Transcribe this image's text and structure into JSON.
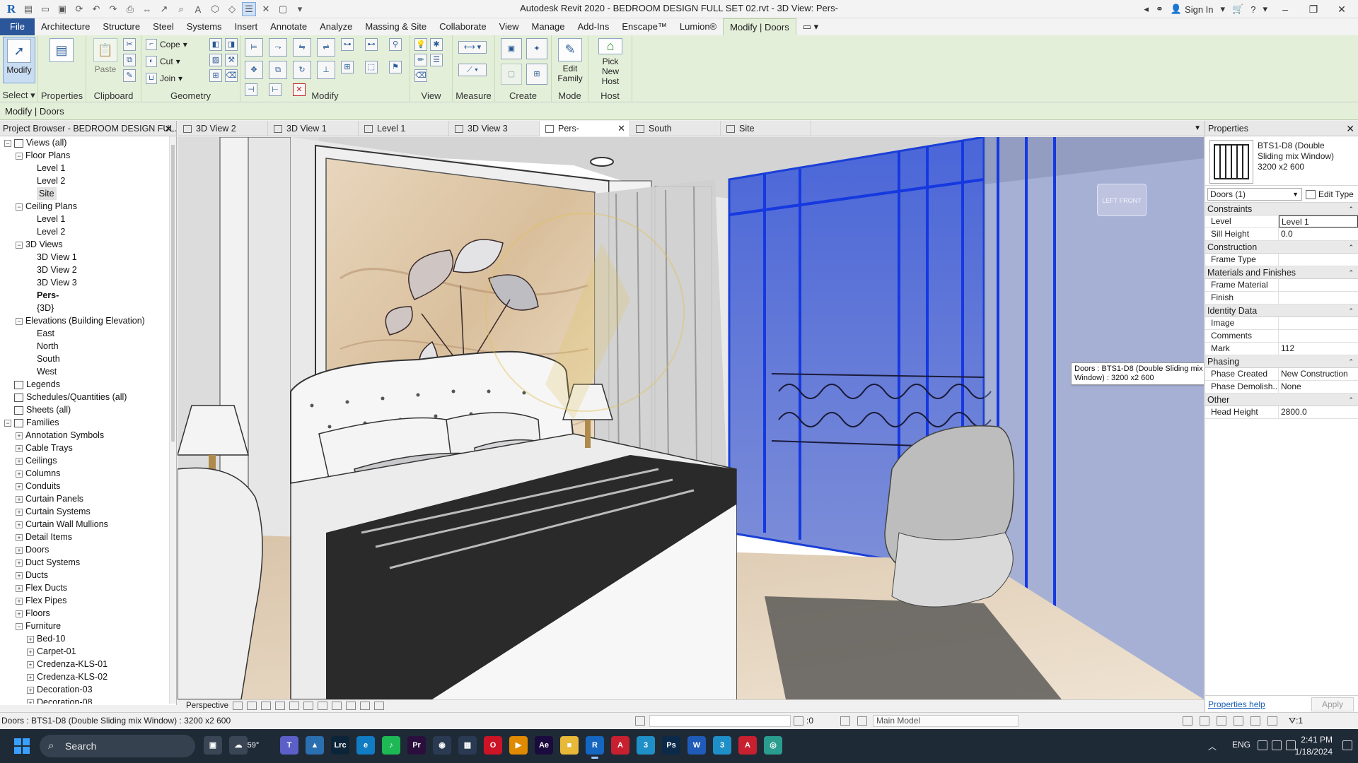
{
  "window": {
    "title": "Autodesk Revit 2020 - BEDROOM DESIGN FULL SET 02.rvt - 3D View: Pers-",
    "sign_in": "Sign In",
    "app_logo": "R"
  },
  "ribbon_tabs": [
    "File",
    "Architecture",
    "Structure",
    "Steel",
    "Systems",
    "Insert",
    "Annotate",
    "Analyze",
    "Massing & Site",
    "Collaborate",
    "View",
    "Manage",
    "Add-Ins",
    "Enscape™",
    "Lumion®",
    "Modify | Doors"
  ],
  "ribbon": {
    "select_panel": {
      "modify_label": "Modify",
      "label": "Select"
    },
    "properties_panel": {
      "label": "Properties"
    },
    "clipboard_panel": {
      "paste_label": "Paste",
      "label": "Clipboard"
    },
    "geometry_panel": {
      "cope": "Cope",
      "cut": "Cut",
      "join": "Join",
      "label": "Geometry"
    },
    "modify_panel": {
      "label": "Modify"
    },
    "view_panel": {
      "label": "View"
    },
    "measure_panel": {
      "label": "Measure"
    },
    "create_panel": {
      "label": "Create"
    },
    "mode_panel": {
      "edit_family": "Edit Family",
      "label": "Mode"
    },
    "host_panel": {
      "pick_new_host": "Pick New Host",
      "label": "Host"
    }
  },
  "context_bar": "Modify | Doors",
  "project_browser": {
    "title": "Project Browser - BEDROOM DESIGN FUL...",
    "nodes": [
      {
        "label": "Views (all)",
        "indent": 0,
        "toggle": "-",
        "icon": true
      },
      {
        "label": "Floor Plans",
        "indent": 1,
        "toggle": "-"
      },
      {
        "label": "Level 1",
        "indent": 2
      },
      {
        "label": "Level 2",
        "indent": 2
      },
      {
        "label": "Site",
        "indent": 2,
        "highlight": true
      },
      {
        "label": "Ceiling Plans",
        "indent": 1,
        "toggle": "-"
      },
      {
        "label": "Level 1",
        "indent": 2
      },
      {
        "label": "Level 2",
        "indent": 2
      },
      {
        "label": "3D Views",
        "indent": 1,
        "toggle": "-"
      },
      {
        "label": "3D View 1",
        "indent": 2
      },
      {
        "label": "3D View 2",
        "indent": 2
      },
      {
        "label": "3D View 3",
        "indent": 2
      },
      {
        "label": "Pers-",
        "indent": 2,
        "bold": true
      },
      {
        "label": "{3D}",
        "indent": 2
      },
      {
        "label": "Elevations (Building Elevation)",
        "indent": 1,
        "toggle": "-"
      },
      {
        "label": "East",
        "indent": 2
      },
      {
        "label": "North",
        "indent": 2
      },
      {
        "label": "South",
        "indent": 2
      },
      {
        "label": "West",
        "indent": 2
      },
      {
        "label": "Legends",
        "indent": 0,
        "icon": true
      },
      {
        "label": "Schedules/Quantities (all)",
        "indent": 0,
        "icon": true
      },
      {
        "label": "Sheets (all)",
        "indent": 0,
        "icon": true
      },
      {
        "label": "Families",
        "indent": 0,
        "toggle": "-",
        "icon": true
      },
      {
        "label": "Annotation Symbols",
        "indent": 1,
        "toggle": "+"
      },
      {
        "label": "Cable Trays",
        "indent": 1,
        "toggle": "+"
      },
      {
        "label": "Ceilings",
        "indent": 1,
        "toggle": "+"
      },
      {
        "label": "Columns",
        "indent": 1,
        "toggle": "+"
      },
      {
        "label": "Conduits",
        "indent": 1,
        "toggle": "+"
      },
      {
        "label": "Curtain Panels",
        "indent": 1,
        "toggle": "+"
      },
      {
        "label": "Curtain Systems",
        "indent": 1,
        "toggle": "+"
      },
      {
        "label": "Curtain Wall Mullions",
        "indent": 1,
        "toggle": "+"
      },
      {
        "label": "Detail Items",
        "indent": 1,
        "toggle": "+"
      },
      {
        "label": "Doors",
        "indent": 1,
        "toggle": "+"
      },
      {
        "label": "Duct Systems",
        "indent": 1,
        "toggle": "+"
      },
      {
        "label": "Ducts",
        "indent": 1,
        "toggle": "+"
      },
      {
        "label": "Flex Ducts",
        "indent": 1,
        "toggle": "+"
      },
      {
        "label": "Flex Pipes",
        "indent": 1,
        "toggle": "+"
      },
      {
        "label": "Floors",
        "indent": 1,
        "toggle": "+"
      },
      {
        "label": "Furniture",
        "indent": 1,
        "toggle": "-"
      },
      {
        "label": "Bed-10",
        "indent": 2,
        "toggle": "+"
      },
      {
        "label": "Carpet-01",
        "indent": 2,
        "toggle": "+"
      },
      {
        "label": "Credenza-KLS-01",
        "indent": 2,
        "toggle": "+"
      },
      {
        "label": "Credenza-KLS-02",
        "indent": 2,
        "toggle": "+"
      },
      {
        "label": "Decoration-03",
        "indent": 2,
        "toggle": "+"
      },
      {
        "label": "Decoration-08",
        "indent": 2,
        "toggle": "+"
      }
    ]
  },
  "view_tabs": [
    {
      "label": "3D View 2",
      "active": false
    },
    {
      "label": "3D View 1",
      "active": false
    },
    {
      "label": "Level 1",
      "active": false
    },
    {
      "label": "3D View 3",
      "active": false
    },
    {
      "label": "Pers-",
      "active": true
    },
    {
      "label": "South",
      "active": false
    },
    {
      "label": "Site",
      "active": false
    }
  ],
  "viewport": {
    "view_cube_label": "LEFT FRONT",
    "tooltip": "Doors : BTS1-D8 (Double Sliding mix Window) : 3200 x2 600"
  },
  "view_control_bar": {
    "scale": "Perspective"
  },
  "properties": {
    "title": "Properties",
    "type_name": "BTS1-D8 (Double Sliding mix Window) 3200 x2 600",
    "instance_selector": "Doors (1)",
    "edit_type": "Edit Type",
    "groups": [
      {
        "name": "Constraints",
        "rows": [
          {
            "name": "Level",
            "value": "Level 1",
            "edit": true
          },
          {
            "name": "Sill Height",
            "value": "0.0"
          }
        ]
      },
      {
        "name": "Construction",
        "rows": [
          {
            "name": "Frame Type",
            "value": ""
          }
        ]
      },
      {
        "name": "Materials and Finishes",
        "rows": [
          {
            "name": "Frame Material",
            "value": ""
          },
          {
            "name": "Finish",
            "value": ""
          }
        ]
      },
      {
        "name": "Identity Data",
        "rows": [
          {
            "name": "Image",
            "value": ""
          },
          {
            "name": "Comments",
            "value": ""
          },
          {
            "name": "Mark",
            "value": "112"
          }
        ]
      },
      {
        "name": "Phasing",
        "rows": [
          {
            "name": "Phase Created",
            "value": "New Construction"
          },
          {
            "name": "Phase Demolish...",
            "value": "None"
          }
        ]
      },
      {
        "name": "Other",
        "rows": [
          {
            "name": "Head Height",
            "value": "2800.0"
          }
        ]
      }
    ],
    "help_link": "Properties help",
    "apply": "Apply"
  },
  "status_bar": {
    "text": "Doors : BTS1-D8 (Double Sliding mix Window) : 3200 x2 600",
    "zero": ":0",
    "model": "Main Model",
    "filter": ":1"
  },
  "taskbar": {
    "search": "Search",
    "weather": "59°",
    "language": "ENG",
    "time": "2:41 PM",
    "date": "1/18/2024",
    "apps": [
      {
        "name": "task-view",
        "label": "▣",
        "color": "#3a4656"
      },
      {
        "name": "widgets",
        "label": "☁",
        "color": "#3a4656"
      },
      {
        "name": "teams",
        "label": "T",
        "color": "#5b5fc7"
      },
      {
        "name": "photos",
        "label": "▲",
        "color": "#2a6fb0"
      },
      {
        "name": "lightroom",
        "label": "Lrc",
        "color": "#0c2438"
      },
      {
        "name": "edge",
        "label": "e",
        "color": "#0f7cc4"
      },
      {
        "name": "spotify",
        "label": "♪",
        "color": "#1db954"
      },
      {
        "name": "premiere",
        "label": "Pr",
        "color": "#2a0f3d"
      },
      {
        "name": "steam",
        "label": "◉",
        "color": "#2a3a52"
      },
      {
        "name": "calculator",
        "label": "▦",
        "color": "#2a3a52"
      },
      {
        "name": "opera",
        "label": "O",
        "color": "#cc1426"
      },
      {
        "name": "media",
        "label": "▶",
        "color": "#e08a00"
      },
      {
        "name": "after-effects",
        "label": "Ae",
        "color": "#1a0a3d"
      },
      {
        "name": "file-explorer",
        "label": "■",
        "color": "#e8b838"
      },
      {
        "name": "revit",
        "label": "R",
        "color": "#1566c0",
        "active": true
      },
      {
        "name": "autocad",
        "label": "A",
        "color": "#c8202f"
      },
      {
        "name": "app-3",
        "label": "3",
        "color": "#1f8fc8"
      },
      {
        "name": "photoshop",
        "label": "Ps",
        "color": "#0b2a4a"
      },
      {
        "name": "word",
        "label": "W",
        "color": "#1f5bb8"
      },
      {
        "name": "app-3b",
        "label": "3",
        "color": "#1f8fc8"
      },
      {
        "name": "autocad-2",
        "label": "A",
        "color": "#c8202f"
      },
      {
        "name": "browser",
        "label": "◎",
        "color": "#2a9d8f"
      }
    ]
  }
}
